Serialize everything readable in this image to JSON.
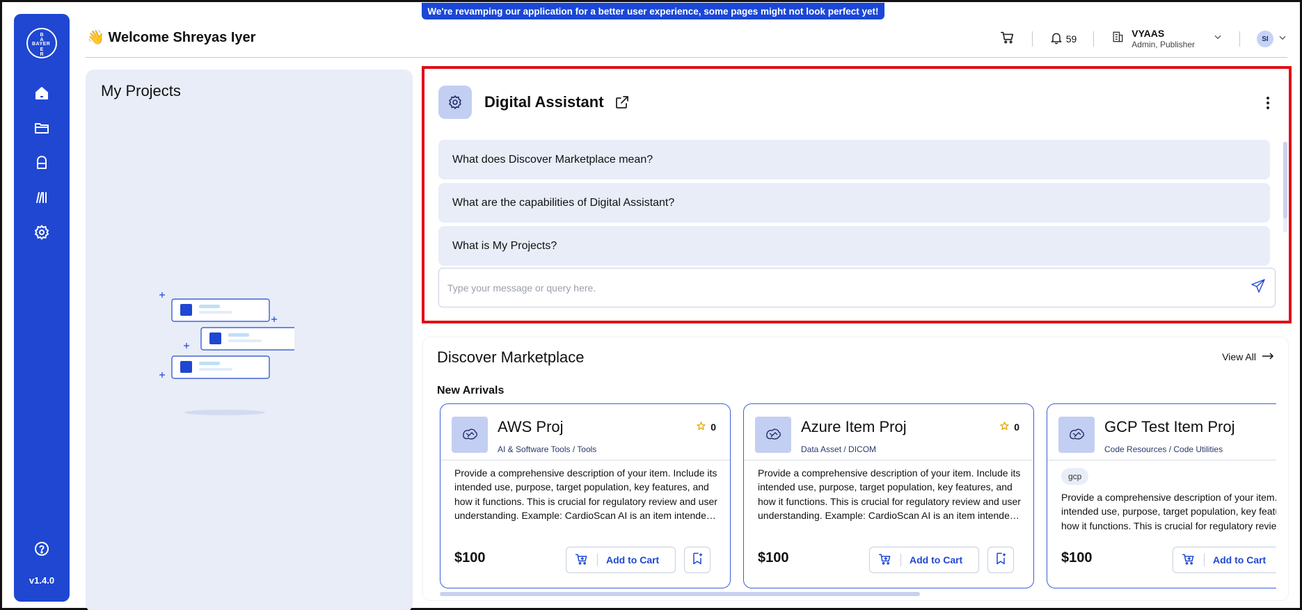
{
  "banner": "We're revamping our application for a better user experience, some pages might not look perfect yet!",
  "sidebar": {
    "logo_text": "BAYER",
    "version": "v1.4.0",
    "items": [
      {
        "icon": "home-icon"
      },
      {
        "icon": "folder-icon"
      },
      {
        "icon": "bag-icon"
      },
      {
        "icon": "library-icon"
      },
      {
        "icon": "settings-icon"
      }
    ],
    "help_icon": "help-icon"
  },
  "header": {
    "welcome": "👋 Welcome Shreyas Iyer",
    "notification_count": "59",
    "user_name": "VYAAS",
    "user_role": "Admin, Publisher",
    "avatar_initials": "SI"
  },
  "projects": {
    "title": "My Projects"
  },
  "assistant": {
    "title": "Digital Assistant",
    "suggestions": [
      "What does Discover Marketplace mean?",
      "What are the capabilities of Digital Assistant?",
      "What is My Projects?"
    ],
    "input_placeholder": "Type your message or query here."
  },
  "marketplace": {
    "title": "Discover Marketplace",
    "view_all": "View All",
    "section": "New Arrivals",
    "cards": [
      {
        "title": "AWS Proj",
        "category": "AI & Software Tools / Tools",
        "rating": "0",
        "tag": "",
        "description": "Provide a comprehensive description of your item. Include its intended use, purpose, target population, key features, and how it functions. This is crucial for regulatory review and user understanding. Example: CardioScan AI is an item intended to assist cardiologists in analyzing ECG data.",
        "price": "$100",
        "cart_label": "Add to Cart"
      },
      {
        "title": "Azure Item Proj",
        "category": "Data Asset / DICOM",
        "rating": "0",
        "tag": "",
        "description": "Provide a comprehensive description of your item. Include its intended use, purpose, target population, key features, and how it functions. This is crucial for regulatory review and user understanding. Example: CardioScan AI is an item intended to assist cardiologists in analyzing ECG data.",
        "price": "$100",
        "cart_label": "Add to Cart"
      },
      {
        "title": "GCP Test Item Proj",
        "category": "Code Resources / Code Utilities",
        "rating": "",
        "tag": "gcp",
        "description": "Provide a comprehensive description of your item. Include its intended use, purpose, target population, key features, and how it functions. This is crucial for regulatory review and user understanding.",
        "price": "$100",
        "cart_label": "Add to Cart"
      }
    ]
  },
  "colors": {
    "accent": "#1f47d1",
    "highlight": "#e10d17",
    "panel": "#e8edf8"
  }
}
